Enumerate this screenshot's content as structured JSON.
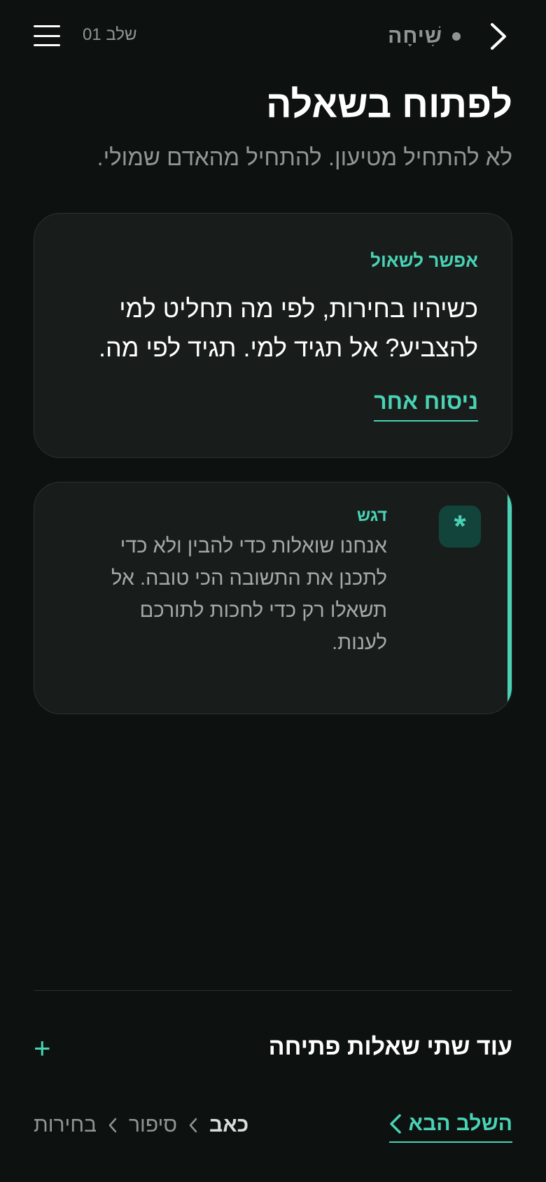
{
  "header": {
    "logo_text": "שִׁיחָה",
    "step_label": "שלב 01"
  },
  "title": "לפתוח בשאלה",
  "subtitle": "לא להתחיל מטיעון. להתחיל מהאדם שמולי.",
  "question_card": {
    "label": "אפשר לשאול",
    "text": "כשיהיו בחירות, לפי מה תחליט למי להצביע? אל תגיד למי. תגיד לפי מה.",
    "alt_link": "ניסוח אחר"
  },
  "emphasis_card": {
    "icon": "asterisk-icon",
    "icon_glyph": "*",
    "label": "דגש",
    "text": "אנחנו שואלות כדי להבין ולא כדי לתכנן את התשובה הכי טובה. אל תשאלו רק כדי לחכות לתורכם לענות."
  },
  "more": {
    "label": "עוד שתי שאלות פתיחה",
    "icon_glyph": "+"
  },
  "next": {
    "label": "השלב הבא"
  },
  "breadcrumb": {
    "items": [
      "כאב",
      "סיפור",
      "בחירות"
    ]
  },
  "colors": {
    "background": "#0d1110",
    "card": "#181d1c",
    "accent": "#49d3b4",
    "muted_text": "#8f9694"
  }
}
